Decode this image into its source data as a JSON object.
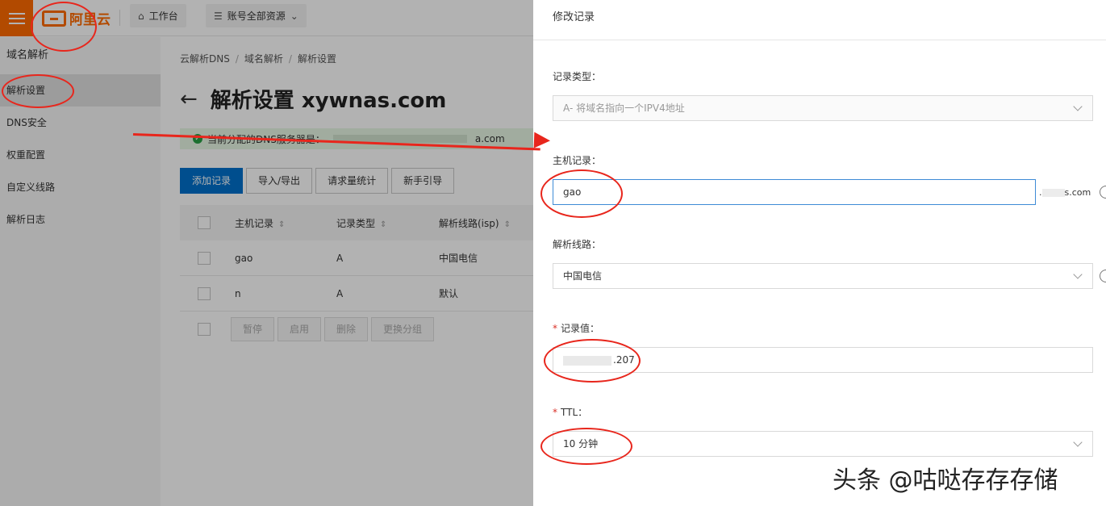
{
  "topbar": {
    "logo_text": "阿里云",
    "workbench_label": "工作台",
    "resources_label": "账号全部资源",
    "resources_icon": "list-icon",
    "workbench_icon": "home-icon"
  },
  "sidebar": {
    "title": "域名解析",
    "items": [
      {
        "label": "解析设置"
      },
      {
        "label": "DNS安全"
      },
      {
        "label": "权重配置"
      },
      {
        "label": "自定义线路"
      },
      {
        "label": "解析日志"
      }
    ]
  },
  "main": {
    "breadcrumb": [
      "云解析DNS",
      "域名解析",
      "解析设置"
    ],
    "title": "解析设置 xywnas.com",
    "notice_prefix": "当前分配的DNS服务器是：",
    "notice_suffix": "a.com",
    "actions": [
      "添加记录",
      "导入/导出",
      "请求量统计",
      "新手引导"
    ],
    "table": {
      "headers": [
        "主机记录",
        "记录类型",
        "解析线路(isp)"
      ],
      "rows": [
        {
          "host": "gao",
          "type": "A",
          "line": "中国电信"
        },
        {
          "host": "n",
          "type": "A",
          "line": "默认"
        }
      ]
    },
    "bulk_actions": [
      "暂停",
      "启用",
      "删除",
      "更换分组"
    ]
  },
  "drawer": {
    "title": "修改记录",
    "record_type": {
      "label": "记录类型：",
      "value": "A- 将域名指向一个IPV4地址"
    },
    "host": {
      "label": "主机记录：",
      "value": "gao",
      "suffix": "s.com",
      "suffix_prefix": "."
    },
    "line": {
      "label": "解析线路：",
      "value": "中国电信"
    },
    "record_value": {
      "label": "记录值：",
      "value": ".207"
    },
    "ttl": {
      "label": "TTL：",
      "value": "10 分钟"
    },
    "required_mark": "*"
  },
  "watermark": "头条 @咕哒存存存储",
  "colors": {
    "brand": "#ff6a00",
    "primary": "#0070cc",
    "annotation": "#e8261c"
  }
}
